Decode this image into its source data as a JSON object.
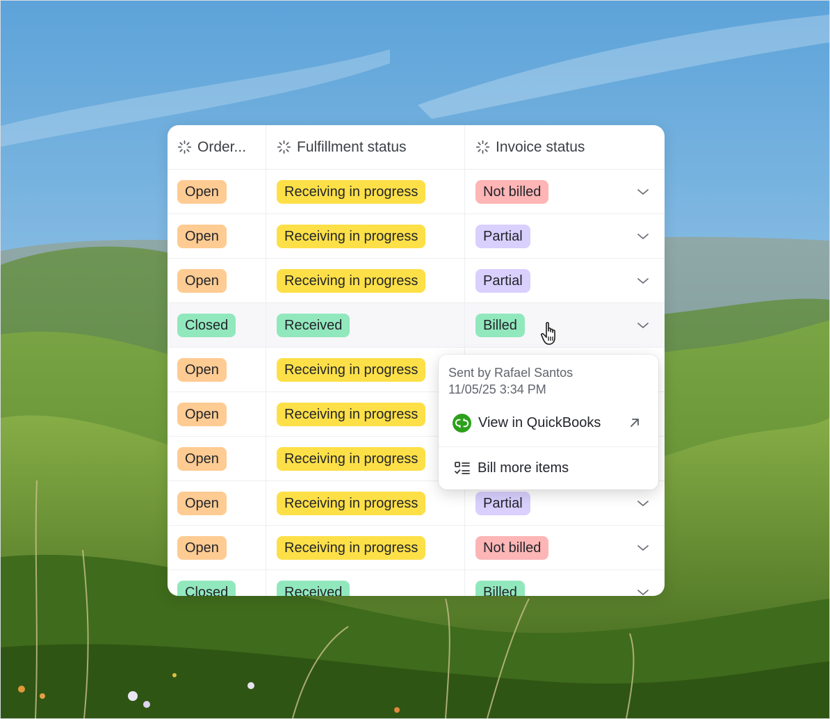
{
  "table": {
    "headers": [
      {
        "label": "Order...",
        "icon": "loading-spinner-icon"
      },
      {
        "label": "Fulfillment status",
        "icon": "loading-spinner-icon"
      },
      {
        "label": "Invoice status",
        "icon": "loading-spinner-icon"
      }
    ],
    "rows": [
      {
        "order": "Open",
        "fulfillment": "Receiving in progress",
        "invoice": "Not billed"
      },
      {
        "order": "Open",
        "fulfillment": "Receiving in progress",
        "invoice": "Partial"
      },
      {
        "order": "Open",
        "fulfillment": "Receiving in progress",
        "invoice": "Partial"
      },
      {
        "order": "Closed",
        "fulfillment": "Received",
        "invoice": "Billed"
      },
      {
        "order": "Open",
        "fulfillment": "Receiving in progress",
        "invoice": ""
      },
      {
        "order": "Open",
        "fulfillment": "Receiving in progress",
        "invoice": ""
      },
      {
        "order": "Open",
        "fulfillment": "Receiving in progress",
        "invoice": ""
      },
      {
        "order": "Open",
        "fulfillment": "Receiving in progress",
        "invoice": "Partial"
      },
      {
        "order": "Open",
        "fulfillment": "Receiving in progress",
        "invoice": "Not billed"
      },
      {
        "order": "Closed",
        "fulfillment": "Received",
        "invoice": "Billed"
      }
    ]
  },
  "popover": {
    "sent_by": "Sent by Rafael Santos",
    "sent_at": "11/05/25 3:34 PM",
    "view_label": "View in QuickBooks",
    "bill_label": "Bill more items"
  },
  "colors": {
    "Open": "#fecb92",
    "Closed": "#92e8bd",
    "Receiving in progress": "#fde047",
    "Received": "#92e8bd",
    "Not billed": "#fdb5b5",
    "Partial": "#d9d0fe",
    "Billed": "#92e8bd",
    "quickbooks": "#2ca01c"
  }
}
